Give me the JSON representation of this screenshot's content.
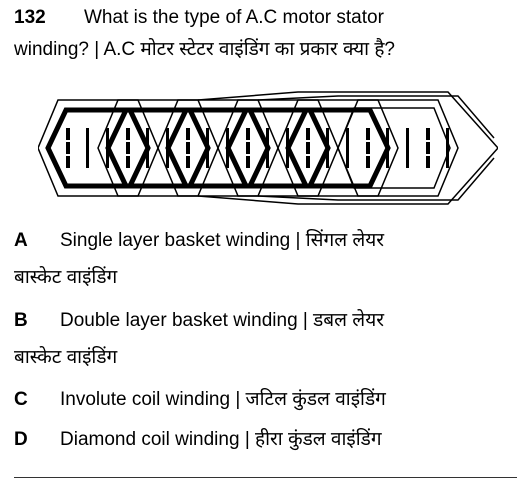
{
  "question": {
    "number": "132",
    "text_line1": "What is the type of A.C motor stator",
    "text_line2": "winding? | A.C मोटर स्टेटर वाइंडिंग का प्रकार क्या है?"
  },
  "figure": {
    "icon": "stator-winding-diagram",
    "colors": {
      "ink": "#000000"
    }
  },
  "options": [
    {
      "letter": "A",
      "line1": "Single layer basket winding | सिंगल लेयर",
      "line2": "बास्केट वाइंडिंग"
    },
    {
      "letter": "B",
      "line1": "Double layer basket winding | डबल लेयर",
      "line2": "बास्केट वाइंडिंग"
    },
    {
      "letter": "C",
      "line1": "Involute coil winding | जटिल कुंडल वाइंडिंग"
    },
    {
      "letter": "D",
      "line1": "Diamond coil winding | हीरा कुंडल वाइंडिंग"
    }
  ]
}
